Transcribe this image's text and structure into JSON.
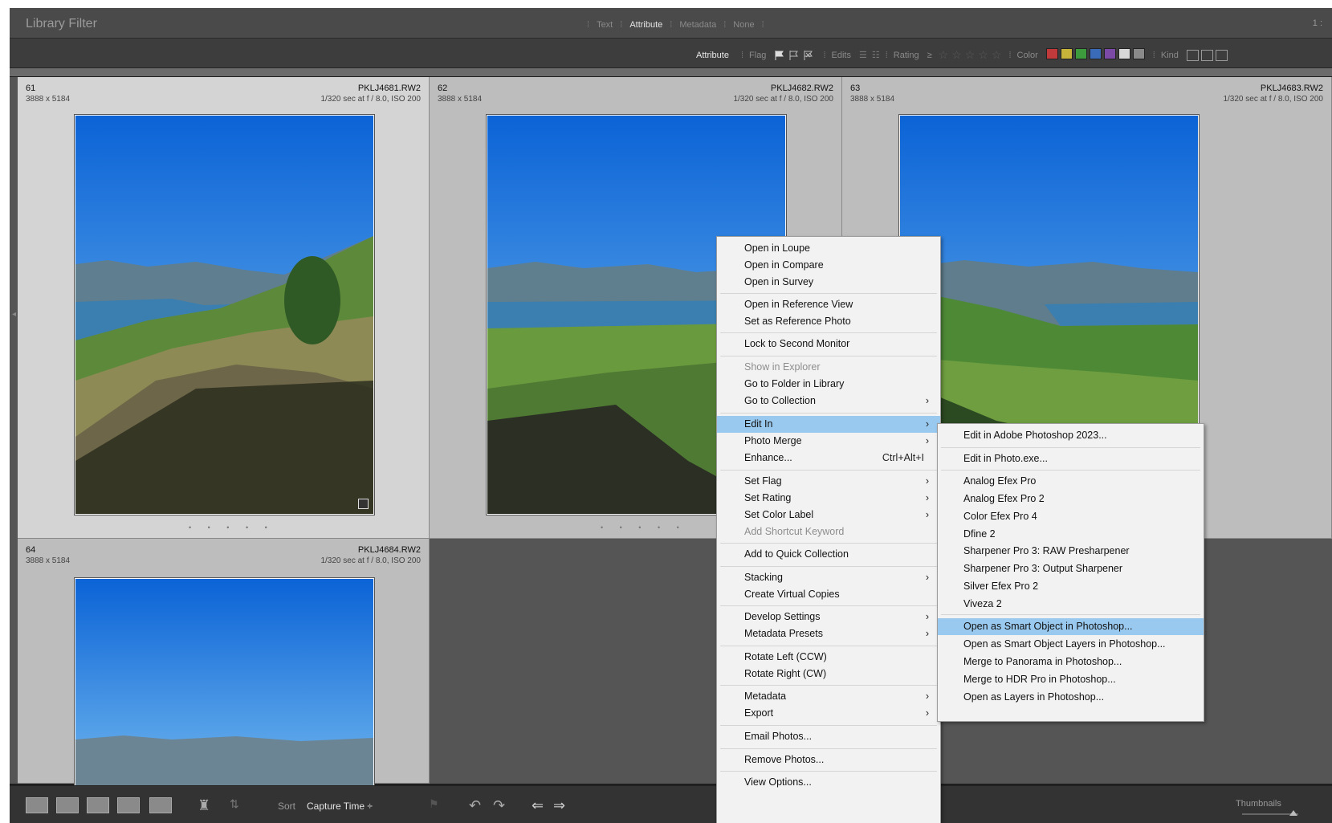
{
  "filter_bar": {
    "title": "Library Filter",
    "tabs": [
      {
        "label": "Text"
      },
      {
        "label": "Attribute"
      },
      {
        "label": "Metadata"
      },
      {
        "label": "None"
      }
    ],
    "active_tab": "Attribute",
    "right_text": "1 :"
  },
  "attribute_bar": {
    "label": "Attribute",
    "flag_label": "Flag",
    "edits_label": "Edits",
    "rating_label": "Rating",
    "rating_op": "≥",
    "color_label": "Color",
    "kind_label": "Kind",
    "stars": [
      "☆",
      "☆",
      "☆",
      "☆",
      "☆"
    ],
    "swatch_colors": [
      "#c0393b",
      "#c8b33a",
      "#3d9a3d",
      "#3a6bb8",
      "#7a4aa6",
      "#d8d8d8",
      "#8a8a8a"
    ]
  },
  "grid": {
    "cells": [
      {
        "num": "61",
        "dims": "3888 x 5184",
        "file": "PKLJ4681.RW2",
        "exif": "1/320 sec at f / 8.0, ISO 200"
      },
      {
        "num": "62",
        "dims": "3888 x 5184",
        "file": "PKLJ4682.RW2",
        "exif": "1/320 sec at f / 8.0, ISO 200"
      },
      {
        "num": "63",
        "dims": "3888 x 5184",
        "file": "PKLJ4683.RW2",
        "exif": "1/320 sec at f / 8.0, ISO 200"
      },
      {
        "num": "64",
        "dims": "3888 x 5184",
        "file": "PKLJ4684.RW2",
        "exif": "1/320 sec at f / 8.0, ISO 200"
      }
    ],
    "dots": "• • • • •"
  },
  "toolbar": {
    "sort_label": "Sort",
    "sort_value": "Capture Time ÷",
    "thumbnails_label": "Thumbnails"
  },
  "context_menu": {
    "items": [
      {
        "label": "Open in Loupe"
      },
      {
        "label": "Open in Compare"
      },
      {
        "label": "Open in Survey"
      },
      {
        "label": "Open in Reference View"
      },
      {
        "label": "Set as Reference Photo"
      },
      {
        "label": "Lock to Second Monitor"
      },
      {
        "label": "Show in Explorer",
        "disabled": true
      },
      {
        "label": "Go to Folder in Library"
      },
      {
        "label": "Go to Collection",
        "submenu": true
      },
      {
        "label": "Edit In",
        "submenu": true,
        "highlighted": true
      },
      {
        "label": "Photo Merge",
        "submenu": true
      },
      {
        "label": "Enhance...",
        "shortcut": "Ctrl+Alt+I"
      },
      {
        "label": "Set Flag",
        "submenu": true
      },
      {
        "label": "Set Rating",
        "submenu": true
      },
      {
        "label": "Set Color Label",
        "submenu": true
      },
      {
        "label": "Add Shortcut Keyword",
        "disabled": true
      },
      {
        "label": "Add to Quick Collection"
      },
      {
        "label": "Stacking",
        "submenu": true
      },
      {
        "label": "Create Virtual Copies"
      },
      {
        "label": "Develop Settings",
        "submenu": true
      },
      {
        "label": "Metadata Presets",
        "submenu": true
      },
      {
        "label": "Rotate Left (CCW)"
      },
      {
        "label": "Rotate Right (CW)"
      },
      {
        "label": "Metadata",
        "submenu": true
      },
      {
        "label": "Export",
        "submenu": true
      },
      {
        "label": "Email Photos..."
      },
      {
        "label": "Remove Photos..."
      },
      {
        "label": "View Options..."
      }
    ],
    "arrow": "›"
  },
  "edit_in_submenu": {
    "items": [
      {
        "label": "Edit in Adobe Photoshop 2023..."
      },
      {
        "label": "Edit in Photo.exe..."
      },
      {
        "label": "Analog Efex Pro"
      },
      {
        "label": "Analog Efex Pro 2"
      },
      {
        "label": "Color Efex Pro 4"
      },
      {
        "label": "Dfine 2"
      },
      {
        "label": "Sharpener Pro 3: RAW Presharpener"
      },
      {
        "label": "Sharpener Pro 3: Output Sharpener"
      },
      {
        "label": "Silver Efex Pro 2"
      },
      {
        "label": "Viveza 2"
      },
      {
        "label": "Open as Smart Object in Photoshop...",
        "highlighted": true
      },
      {
        "label": "Open as Smart Object Layers in Photoshop..."
      },
      {
        "label": "Merge to Panorama in Photoshop..."
      },
      {
        "label": "Merge to HDR Pro in Photoshop..."
      },
      {
        "label": "Open as Layers in Photoshop..."
      }
    ]
  }
}
